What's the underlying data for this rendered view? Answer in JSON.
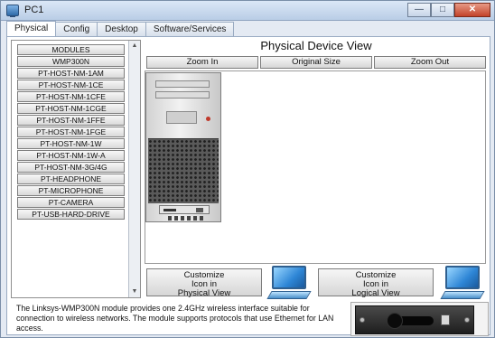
{
  "window": {
    "title": "PC1"
  },
  "tabs": [
    {
      "label": "Physical",
      "active": true
    },
    {
      "label": "Config"
    },
    {
      "label": "Desktop"
    },
    {
      "label": "Software/Services"
    }
  ],
  "modules": {
    "items": [
      "MODULES",
      "WMP300N",
      "PT-HOST-NM-1AM",
      "PT-HOST-NM-1CE",
      "PT-HOST-NM-1CFE",
      "PT-HOST-NM-1CGE",
      "PT-HOST-NM-1FFE",
      "PT-HOST-NM-1FGE",
      "PT-HOST-NM-1W",
      "PT-HOST-NM-1W-A",
      "PT-HOST-NM-3G/4G",
      "PT-HEADPHONE",
      "PT-MICROPHONE",
      "PT-CAMERA",
      "PT-USB-HARD-DRIVE"
    ]
  },
  "view": {
    "title": "Physical Device View",
    "zoom_in": "Zoom In",
    "original_size": "Original Size",
    "zoom_out": "Zoom Out",
    "customize_physical": [
      "Customize",
      "Icon in",
      "Physical View"
    ],
    "customize_logical": [
      "Customize",
      "Icon in",
      "Logical View"
    ]
  },
  "description": "The Linksys-WMP300N module provides one 2.4GHz wireless interface suitable for connection to wireless networks. The module supports protocols that use Ethernet for LAN access.",
  "icons": {
    "app": "pc-icon",
    "monitor": "monitor-icon",
    "module": "wireless-card-image"
  },
  "colors": {
    "title_bar": "#b9cde6",
    "close_button": "#c3432a",
    "panel_bg": "#ffffff"
  }
}
